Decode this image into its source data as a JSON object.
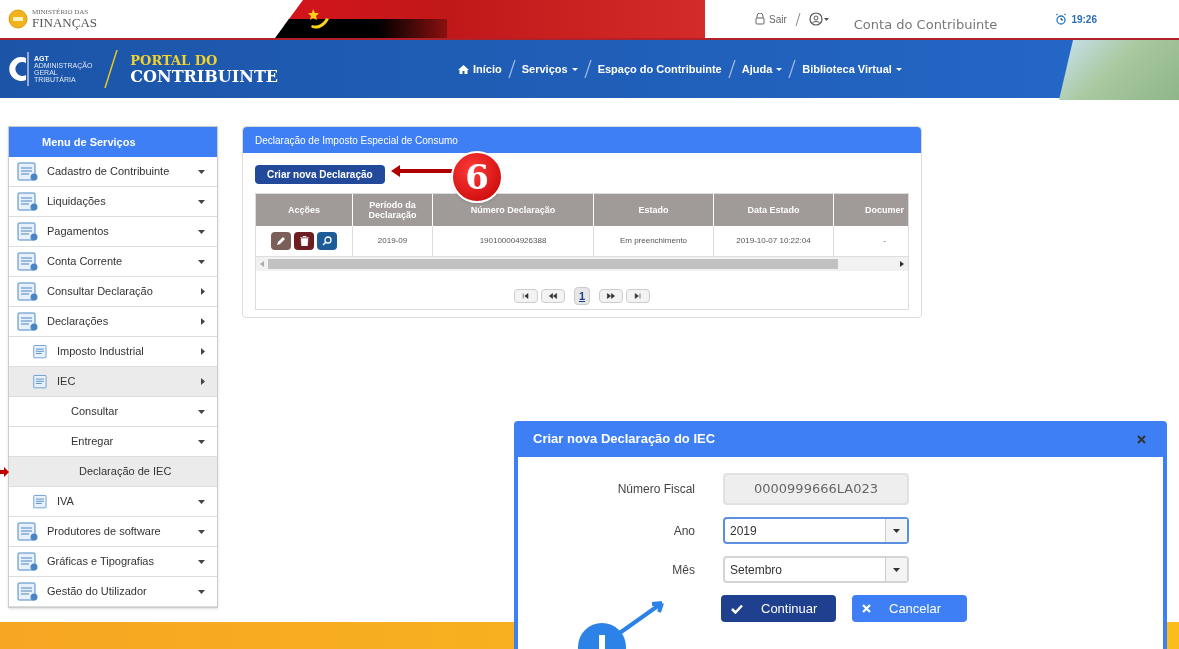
{
  "top_bar": {
    "ministry_small": "MINISTÉRIO DAS",
    "ministry": "FINANÇAS",
    "logout": "Sair",
    "account_title": "Conta do Contribuinte",
    "time": "19:26"
  },
  "brand": {
    "agt": "AGT",
    "agt_lines": [
      "ADMINISTRAÇÃO",
      "GERAL",
      "TRIBUTÁRIA"
    ],
    "portal_top": "PORTAL DO",
    "portal_bottom": "CONTRIBUINTE"
  },
  "nav": [
    {
      "label": "Início",
      "kind": "home",
      "dropdown": false
    },
    {
      "label": "Serviços",
      "kind": "link",
      "dropdown": true
    },
    {
      "label": "Espaço do Contribuinte",
      "kind": "link",
      "dropdown": false
    },
    {
      "label": "Ajuda",
      "kind": "link",
      "dropdown": true
    },
    {
      "label": "Biblioteca Virtual",
      "kind": "link",
      "dropdown": true
    }
  ],
  "sidebar": {
    "title": "Menu de Serviços",
    "items": [
      {
        "label": "Cadastro de Contribuinte",
        "kind": "dropdown",
        "selected": false,
        "pointer": false
      },
      {
        "label": "Liquidações",
        "kind": "dropdown",
        "selected": false,
        "pointer": false
      },
      {
        "label": "Pagamentos",
        "kind": "dropdown",
        "selected": false,
        "pointer": false
      },
      {
        "label": "Conta Corrente",
        "kind": "dropdown",
        "selected": false,
        "pointer": false
      },
      {
        "label": "Consultar Declaração",
        "kind": "submenu",
        "selected": false,
        "pointer": false
      },
      {
        "label": "Declarações",
        "kind": "submenu",
        "selected": false,
        "pointer": false,
        "children": [
          {
            "label": "Imposto Industrial",
            "kind": "submenu",
            "selected": false,
            "pointer": false
          },
          {
            "label": "IEC",
            "kind": "submenu",
            "selected": true,
            "pointer": false,
            "children": [
              {
                "label": "Consultar",
                "kind": "dropdown",
                "selected": false,
                "pointer": false
              },
              {
                "label": "Entregar",
                "kind": "dropdown",
                "selected": false,
                "pointer": false
              },
              {
                "label": "Declaração de IEC",
                "kind": "leaf",
                "selected": true,
                "pointer": true
              }
            ]
          },
          {
            "label": "IVA",
            "kind": "dropdown",
            "selected": false,
            "pointer": false
          }
        ]
      },
      {
        "label": "Produtores de software",
        "kind": "dropdown",
        "selected": false,
        "pointer": false
      },
      {
        "label": "Gráficas e Tipografias",
        "kind": "dropdown",
        "selected": false,
        "pointer": false
      },
      {
        "label": "Gestão do Utilizador",
        "kind": "dropdown",
        "selected": false,
        "pointer": false
      }
    ]
  },
  "panel": {
    "title": "Declaração de Imposto Especial de Consumo",
    "create_button": "Criar nova Declaração",
    "step_badge": "6",
    "table": {
      "columns": [
        "Acções",
        "Período da Declaração",
        "Número Declaração",
        "Estado",
        "Data Estado",
        "Documer"
      ],
      "rows": [
        {
          "period": "2019-09",
          "number": "190100004926388",
          "state": "Em preenchimento",
          "state_date": "2019-10-07 10:22:04",
          "document": "-"
        }
      ]
    },
    "pagination": [
      {
        "kind": "first",
        "selected": false
      },
      {
        "kind": "prev",
        "selected": false
      },
      {
        "kind": "page",
        "label": "1",
        "selected": true
      },
      {
        "kind": "next",
        "selected": false
      },
      {
        "kind": "last",
        "selected": false
      }
    ]
  },
  "dialog": {
    "title": "Criar nova Declaração do IEC",
    "fields": [
      {
        "label": "Número Fiscal",
        "value": "0000999666LA023",
        "kind": "readonly",
        "focused": false
      },
      {
        "label": "Ano",
        "value": "2019",
        "kind": "select",
        "focused": true
      },
      {
        "label": "Mês",
        "value": "Setembro",
        "kind": "select",
        "focused": false
      }
    ],
    "buttons": [
      {
        "label": "Continuar",
        "kind": "primary"
      },
      {
        "label": "Cancelar",
        "kind": "secondary"
      }
    ]
  }
}
